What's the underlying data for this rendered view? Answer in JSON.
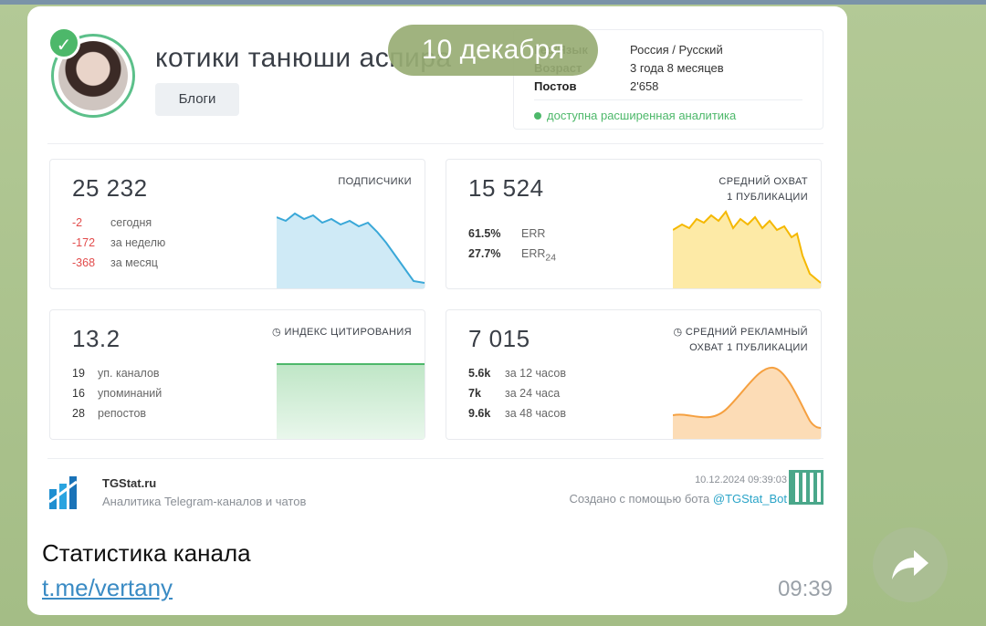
{
  "date_pill": "10 декабря",
  "channel": {
    "name": "котики танюши аспира",
    "category": "Блоги"
  },
  "info": {
    "rows": [
      {
        "key": "Гео/Язык",
        "value": "Россия / Русский"
      },
      {
        "key": "Возраст",
        "value": "3 года 8 месяцев"
      },
      {
        "key": "Постов",
        "value": "2'658"
      }
    ],
    "status": "доступна расширенная аналитика"
  },
  "panels": {
    "subscribers": {
      "value": "25 232",
      "title": "ПОДПИСЧИКИ",
      "rows": [
        {
          "num": "-2",
          "label": "сегодня"
        },
        {
          "num": "-172",
          "label": "за неделю"
        },
        {
          "num": "-368",
          "label": "за месяц"
        }
      ],
      "color": "#3aa8d8"
    },
    "reach": {
      "value": "15 524",
      "title_line1": "СРЕДНИЙ ОХВАТ",
      "title_line2": "1 ПУБЛИКАЦИИ",
      "rows": [
        {
          "num": "61.5%",
          "label": "ERR"
        },
        {
          "num": "27.7%",
          "label": "ERR",
          "sub": "24"
        }
      ],
      "color": "#f5b800"
    },
    "citation": {
      "value": "13.2",
      "title": "ИНДЕКС ЦИТИРОВАНИЯ",
      "rows": [
        {
          "num": "19",
          "label": "уп. каналов"
        },
        {
          "num": "16",
          "label": "упоминаний"
        },
        {
          "num": "28",
          "label": "репостов"
        }
      ],
      "color": "#4db86a"
    },
    "ad_reach": {
      "value": "7 015",
      "title_line1": "СРЕДНИЙ РЕКЛАМНЫЙ",
      "title_line2": "ОХВАТ 1 ПУБЛИКАЦИИ",
      "rows": [
        {
          "num": "5.6k",
          "label": "за 12 часов"
        },
        {
          "num": "7k",
          "label": "за 24 часа"
        },
        {
          "num": "9.6k",
          "label": "за 48 часов"
        }
      ],
      "color": "#f5a040"
    }
  },
  "footer": {
    "brand": "TGStat.ru",
    "subtitle": "Аналитика Telegram-каналов и чатов",
    "timestamp": "10.12.2024 09:39:03",
    "created_prefix": "Создано с помощью бота",
    "bot": "@TGStat_Bot"
  },
  "message": {
    "title": "Статистика канала",
    "link": "t.me/vertany",
    "time": "09:39"
  },
  "icons": {
    "verified": "check-badge-icon",
    "share": "share-arrow-icon",
    "clock": "clock-icon"
  }
}
